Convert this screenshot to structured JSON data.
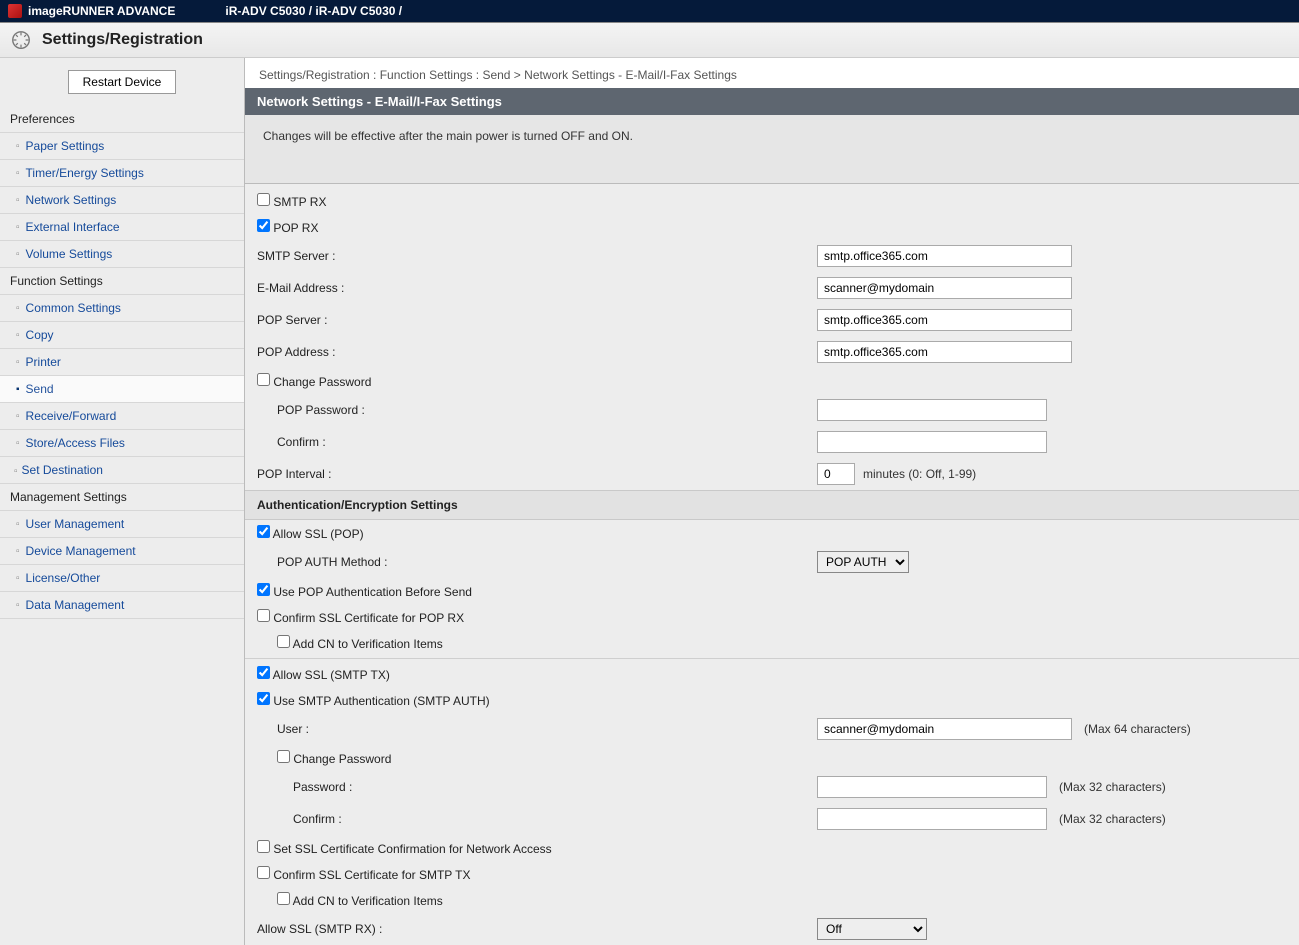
{
  "header": {
    "brand": "imageRUNNER ADVANCE",
    "path": "iR-ADV C5030 / iR-ADV C5030 /",
    "section_title": "Settings/Registration"
  },
  "sidebar": {
    "restart_label": "Restart Device",
    "groups": [
      {
        "title": "Preferences",
        "items": [
          "Paper Settings",
          "Timer/Energy Settings",
          "Network Settings",
          "External Interface",
          "Volume Settings"
        ]
      },
      {
        "title": "Function Settings",
        "items": [
          "Common Settings",
          "Copy",
          "Printer",
          "Send",
          "Receive/Forward",
          "Store/Access Files"
        ],
        "active": "Send"
      },
      {
        "title_link": "Set Destination"
      },
      {
        "title": "Management Settings",
        "items": [
          "User Management",
          "Device Management",
          "License/Other",
          "Data Management"
        ]
      }
    ]
  },
  "breadcrumb": "Settings/Registration : Function Settings : Send > Network Settings - E-Mail/I-Fax Settings",
  "panel_title": "Network Settings - E-Mail/I-Fax Settings",
  "notice": "Changes will be effective after the main power is turned OFF and ON.",
  "form": {
    "smtp_rx": {
      "label": "SMTP RX",
      "checked": false
    },
    "pop_rx": {
      "label": "POP RX",
      "checked": true
    },
    "smtp_server": {
      "label": "SMTP Server :",
      "value": "smtp.office365.com"
    },
    "email_address": {
      "label": "E-Mail Address :",
      "value": "scanner@mydomain"
    },
    "pop_server": {
      "label": "POP Server :",
      "value": "smtp.office365.com"
    },
    "pop_address": {
      "label": "POP Address :",
      "value": "smtp.office365.com"
    },
    "change_pw": {
      "label": "Change Password",
      "checked": false
    },
    "pop_password": {
      "label": "POP Password :"
    },
    "pop_confirm": {
      "label": "Confirm :"
    },
    "pop_interval": {
      "label": "POP Interval :",
      "value": "0",
      "unit": "minutes (0: Off, 1-99)"
    }
  },
  "auth": {
    "heading": "Authentication/Encryption Settings",
    "allow_ssl_pop": {
      "label": "Allow SSL (POP)",
      "checked": true
    },
    "pop_auth_method": {
      "label": "POP AUTH Method :",
      "value": "POP AUTH",
      "options": [
        "POP AUTH"
      ]
    },
    "use_pop_before_send": {
      "label": "Use POP Authentication Before Send",
      "checked": true
    },
    "confirm_ssl_pop": {
      "label": "Confirm SSL Certificate for POP RX",
      "checked": false
    },
    "add_cn_pop": {
      "label": "Add CN to Verification Items",
      "checked": false
    },
    "allow_ssl_smtp_tx": {
      "label": "Allow SSL (SMTP TX)",
      "checked": true
    },
    "use_smtp_auth": {
      "label": "Use SMTP Authentication (SMTP AUTH)",
      "checked": true
    },
    "smtp_user": {
      "label": "User :",
      "value": "scanner@mydomain",
      "hint": "(Max 64 characters)"
    },
    "smtp_change_pw": {
      "label": "Change Password",
      "checked": false
    },
    "smtp_password": {
      "label": "Password :",
      "hint": "(Max 32 characters)"
    },
    "smtp_confirm": {
      "label": "Confirm :",
      "hint": "(Max 32 characters)"
    },
    "set_ssl_confirm_net": {
      "label": "Set SSL Certificate Confirmation for Network Access",
      "checked": false
    },
    "confirm_ssl_smtp_tx": {
      "label": "Confirm SSL Certificate for SMTP TX",
      "checked": false
    },
    "add_cn_smtp": {
      "label": "Add CN to Verification Items",
      "checked": false
    },
    "allow_ssl_smtp_rx": {
      "label": "Allow SSL (SMTP RX) :",
      "value": "Off",
      "options": [
        "Off"
      ]
    }
  }
}
